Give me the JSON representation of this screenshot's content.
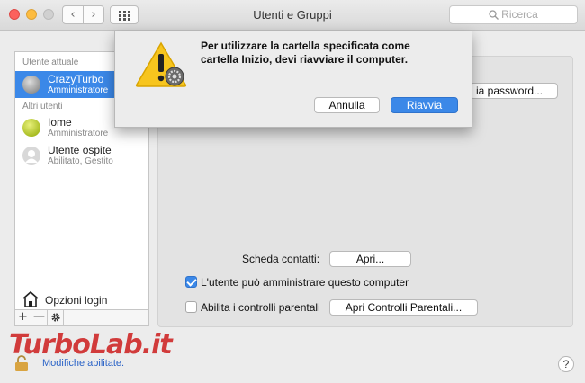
{
  "window": {
    "title": "Utenti e Gruppi"
  },
  "toolbar": {
    "back_icon": "chevron-left-icon",
    "forward_icon": "chevron-right-icon",
    "grid_icon": "grid-icon"
  },
  "search": {
    "placeholder": "Ricerca"
  },
  "sidebar": {
    "current_header": "Utente attuale",
    "others_header": "Altri utenti",
    "users": [
      {
        "name": "CrazyTurbo",
        "role": "Amministratore",
        "selected": true
      },
      {
        "name": "Iome",
        "role": "Amministratore",
        "selected": false
      },
      {
        "name": "Utente ospite",
        "role": "Abilitato, Gestito",
        "selected": false
      }
    ],
    "login_options": "Opzioni login",
    "add": "+",
    "remove": "—"
  },
  "panel": {
    "password_button": "ia password...",
    "contact_card_label": "Scheda contatti:",
    "open_button": "Apri...",
    "admin_checkbox": {
      "label": "L'utente può amministrare questo computer",
      "checked": true
    },
    "parental_checkbox": {
      "label": "Abilita i controlli parentali",
      "checked": false
    },
    "open_parental_button": "Apri Controlli Parentali..."
  },
  "dialog": {
    "message_line1": "Per utilizzare la cartella specificata come",
    "message_line2": "cartella Inizio, devi riavviare il computer.",
    "cancel": "Annulla",
    "restart": "Riavvia"
  },
  "footer": {
    "lock_status": "Modifiche abilitate.",
    "help": "?"
  },
  "watermark": "TurboLab.it",
  "colors": {
    "accent": "#3b88e8",
    "selection": "#3b88e8",
    "link": "#2a63c7"
  }
}
